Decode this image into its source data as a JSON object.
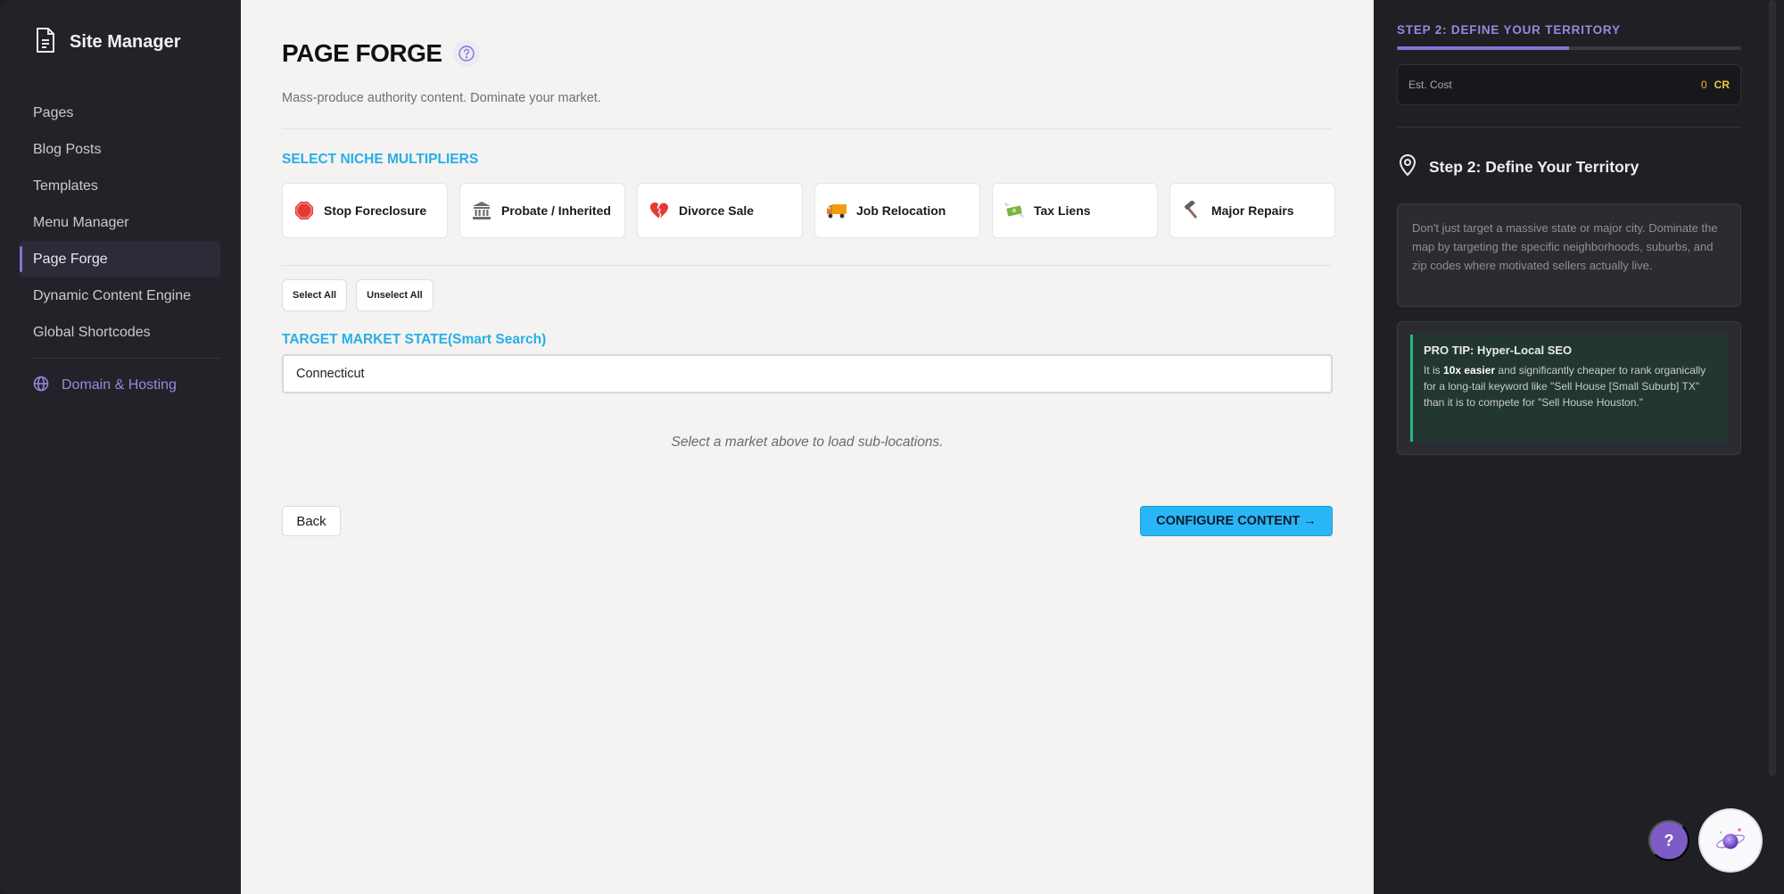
{
  "sidebar": {
    "brand": "Site Manager",
    "items": [
      {
        "label": "Pages"
      },
      {
        "label": "Blog Posts"
      },
      {
        "label": "Templates"
      },
      {
        "label": "Menu Manager"
      },
      {
        "label": "Page Forge",
        "active": true
      },
      {
        "label": "Dynamic Content Engine"
      },
      {
        "label": "Global Shortcodes"
      }
    ],
    "domain_label": "Domain & Hosting"
  },
  "main": {
    "title": "PAGE FORGE",
    "subtitle": "Mass-produce authority content. Dominate your market.",
    "niche_label": "SELECT NICHE MULTIPLIERS",
    "niches": [
      {
        "label": "Stop Foreclosure",
        "icon": "stop-sign-icon"
      },
      {
        "label": "Probate / Inherited",
        "icon": "classical-building-icon"
      },
      {
        "label": "Divorce Sale",
        "icon": "broken-heart-icon"
      },
      {
        "label": "Job Relocation",
        "icon": "moving-truck-icon"
      },
      {
        "label": "Tax Liens",
        "icon": "money-wings-icon"
      },
      {
        "label": "Major Repairs",
        "icon": "hammer-icon"
      }
    ],
    "select_all": "Select All",
    "unselect_all": "Unselect All",
    "state_label": "TARGET MARKET STATE(Smart Search)",
    "state_value": "Connecticut",
    "hint": "Select a market above to load sub-locations.",
    "back": "Back",
    "configure": "CONFIGURE CONTENT →"
  },
  "panel": {
    "step": "STEP 2: DEFINE YOUR TERRITORY",
    "progress": 0.5,
    "cost_label": "Est. Cost",
    "cost_value": "0",
    "cost_unit": "CR",
    "heading": "Step 2: Define Your Territory",
    "info": "Don't just target a massive state or major city. Dominate the map by targeting the specific neighborhoods, suburbs, and zip codes where motivated sellers actually live.",
    "tip_title": "PRO TIP: Hyper-Local SEO",
    "tip_pre": "It is ",
    "tip_bold": "10x easier",
    "tip_post": " and significantly cheaper to rank organically for a long-tail keyword like \"Sell House [Small Suburb] TX\" than it is to compete for \"Sell House Houston.\""
  },
  "fab": {
    "help": "?"
  },
  "colors": {
    "accent": "#8b6fd6",
    "cta": "#29b6f6",
    "section_label": "#27aee8",
    "tip_border": "#28b589"
  }
}
